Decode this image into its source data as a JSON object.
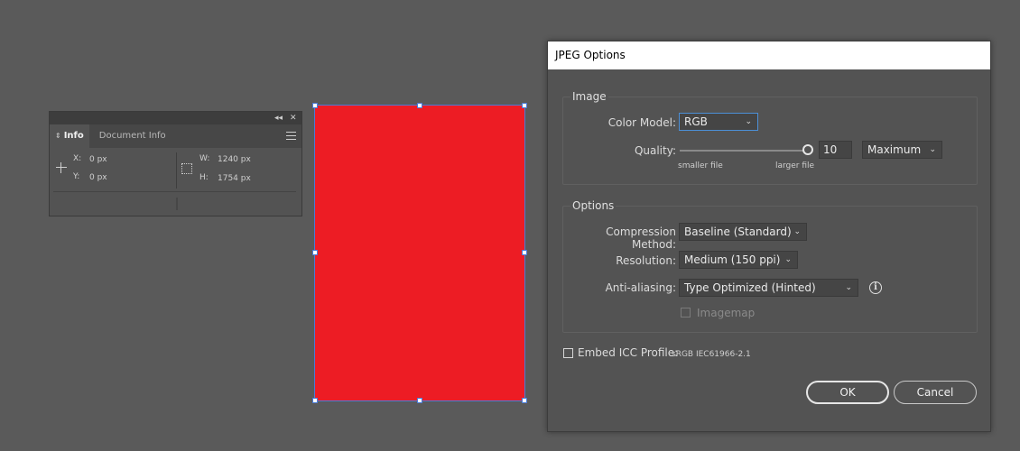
{
  "info_panel": {
    "collapse_glyph": "◂◂",
    "close_glyph": "✕",
    "tabs": [
      {
        "label": "Info",
        "arrows": "⇕",
        "active": true
      },
      {
        "label": "Document Info",
        "active": false
      }
    ],
    "x_label": "X:",
    "x_value": "0 px",
    "y_label": "Y:",
    "y_value": "0 px",
    "w_label": "W:",
    "w_value": "1240 px",
    "h_label": "H:",
    "h_value": "1754 px"
  },
  "artboard": {
    "fill_color": "#ed1c24"
  },
  "dialog": {
    "title": "JPEG Options",
    "image_group": {
      "title": "Image",
      "color_model_label": "Color Model:",
      "color_model_value": "RGB",
      "quality_label": "Quality:",
      "quality_value": "10",
      "quality_preset": "Maximum",
      "smaller_file": "smaller file",
      "larger_file": "larger file"
    },
    "options_group": {
      "title": "Options",
      "compression_label": "Compression Method:",
      "compression_value": "Baseline (Standard)",
      "resolution_label": "Resolution:",
      "resolution_value": "Medium (150 ppi)",
      "antialiasing_label": "Anti-aliasing:",
      "antialiasing_value": "Type Optimized (Hinted)",
      "imagemap_label": "Imagemap"
    },
    "embed_icc_label": "Embed ICC Profile:",
    "icc_profile": "sRGB IEC61966-2.1",
    "ok_label": "OK",
    "cancel_label": "Cancel",
    "chevron": "⌄",
    "info_glyph": "i"
  },
  "colors": {
    "background": "#5a5a5a",
    "panel": "#535353",
    "focus_accent": "#4c8fd6",
    "selection": "#4a7bd6"
  }
}
